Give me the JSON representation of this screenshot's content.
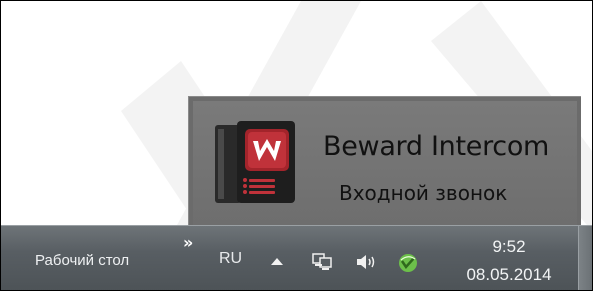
{
  "popup": {
    "title": "Beward Intercom",
    "subtitle": "Входной звонок",
    "icon": "beward-intercom-icon"
  },
  "taskbar": {
    "toolbar_label": "Рабочий стол",
    "toolbar_overflow_glyph": "»",
    "language": "RU",
    "tray_icons": [
      "show-hidden-icons",
      "network-icon",
      "volume-icon",
      "beward-tray-icon"
    ],
    "clock": {
      "time": "9:52",
      "date": "08.05.2014"
    }
  },
  "colors": {
    "popup_background": "#6e6e6e",
    "taskbar_background": "#585e63",
    "app_red": "#a3242b",
    "tray_green": "#6cc04a"
  }
}
